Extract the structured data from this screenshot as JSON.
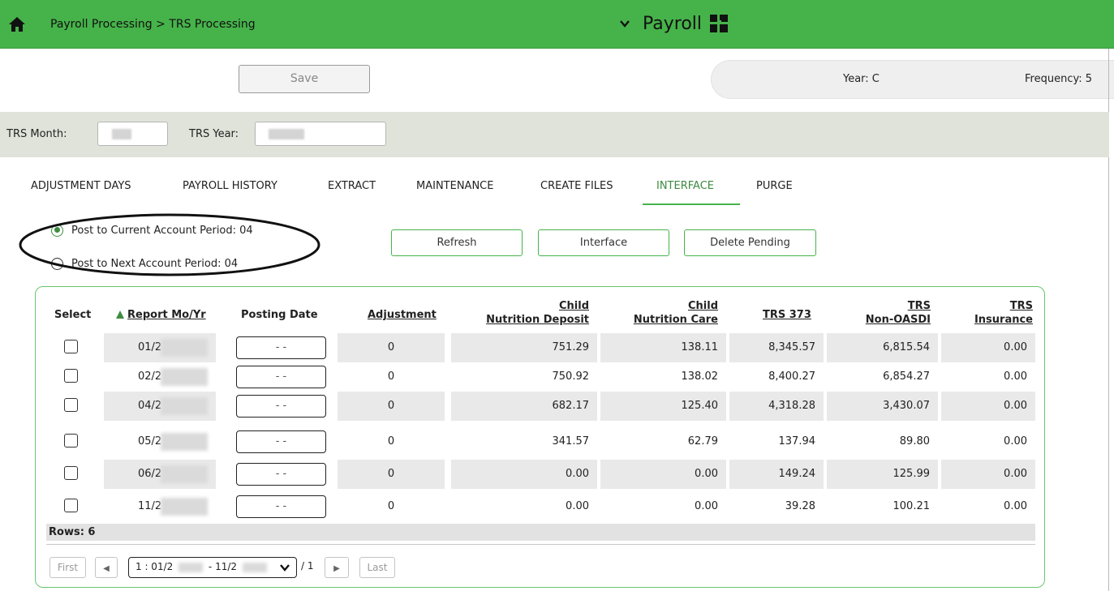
{
  "header": {
    "breadcrumb": "Payroll Processing > TRS Processing",
    "module": "Payroll",
    "bg": "#46b34a"
  },
  "toolbar": {
    "save_label": "Save"
  },
  "info": {
    "year": "Year: C",
    "frequency": "Frequency: 5"
  },
  "filters": {
    "trs_month_label": "TRS Month:",
    "trs_year_label": "TRS Year:"
  },
  "tabs": [
    {
      "label": "ADJUSTMENT DAYS"
    },
    {
      "label": "PAYROLL HISTORY"
    },
    {
      "label": "EXTRACT"
    },
    {
      "label": "MAINTENANCE"
    },
    {
      "label": "CREATE FILES"
    },
    {
      "label": "INTERFACE",
      "active": true
    },
    {
      "label": "PURGE"
    }
  ],
  "options": {
    "current": "Post to Current Account Period: 04",
    "next": "Post to Next Account Period: 04",
    "selected": "current"
  },
  "buttons": {
    "refresh": "Refresh",
    "interface": "Interface",
    "delete_pending": "Delete Pending"
  },
  "table": {
    "headers": {
      "select": "Select",
      "report": "Report Mo/Yr",
      "posting": "Posting Date",
      "adjustment": "Adjustment",
      "child_dep_1": "Child",
      "child_dep_2": "Nutrition Deposit",
      "child_care_1": "Child",
      "child_care_2": "Nutrition Care",
      "trs373": "TRS 373",
      "trs_non_1": "TRS",
      "trs_non_2": "Non-OASDI",
      "trs_ins_1": "TRS",
      "trs_ins_2": "Insurance"
    },
    "rows": [
      {
        "report": "01/2",
        "posting": "- -",
        "adjustment": "0",
        "deposit": "751.29",
        "care": "138.11",
        "trs373": "8,345.57",
        "nonoasdi": "6,815.54",
        "insurance": "0.00"
      },
      {
        "report": "02/2",
        "posting": "- -",
        "adjustment": "0",
        "deposit": "750.92",
        "care": "138.02",
        "trs373": "8,400.27",
        "nonoasdi": "6,854.27",
        "insurance": "0.00"
      },
      {
        "report": "04/2",
        "posting": "- -",
        "adjustment": "0",
        "deposit": "682.17",
        "care": "125.40",
        "trs373": "4,318.28",
        "nonoasdi": "3,430.07",
        "insurance": "0.00"
      },
      {
        "report": "05/2",
        "posting": "- -",
        "adjustment": "0",
        "deposit": "341.57",
        "care": "62.79",
        "trs373": "137.94",
        "nonoasdi": "89.80",
        "insurance": "0.00"
      },
      {
        "report": "06/2",
        "posting": "- -",
        "adjustment": "0",
        "deposit": "0.00",
        "care": "0.00",
        "trs373": "149.24",
        "nonoasdi": "125.99",
        "insurance": "0.00"
      },
      {
        "report": "11/2",
        "posting": "- -",
        "adjustment": "0",
        "deposit": "0.00",
        "care": "0.00",
        "trs373": "39.28",
        "nonoasdi": "100.21",
        "insurance": "0.00"
      }
    ],
    "rows_label": "Rows: 6"
  },
  "pagination": {
    "first": "First",
    "last": "Last",
    "prev_icon": "◀",
    "next_icon": "▶",
    "range_start": "1 : 01/2",
    "range_end": "- 11/2",
    "of": "/ 1"
  }
}
